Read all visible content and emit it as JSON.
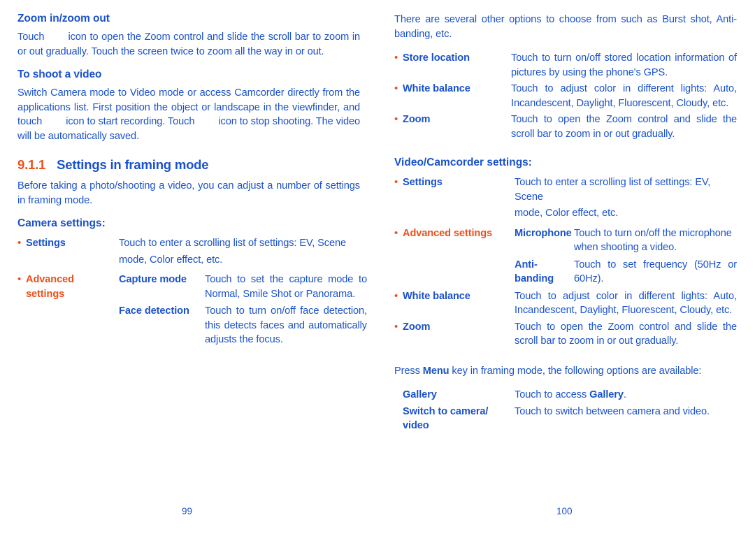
{
  "left_page": {
    "folio": "99",
    "heading_zoom": "Zoom in/zoom out",
    "para_zoom_a": "Touch",
    "para_zoom_b": "icon to open the Zoom control and slide the scroll bar to zoom in or out gradually. Touch the screen twice to zoom all the way in or out.",
    "heading_video": "To shoot a video",
    "para_video_a": "Switch Camera mode to Video mode or access Camcorder directly from the applications list. First position the object or landscape in the viewfinder, and touch",
    "para_video_b": "icon to start recording. Touch",
    "para_video_c": "icon to stop shooting. The video will be automatically saved.",
    "section_number": "9.1.1",
    "section_title": "Settings in framing mode",
    "para_before": "Before taking a photo/shooting a video, you can adjust a number of settings in framing mode.",
    "camera_settings_head": "Camera settings:",
    "rows": [
      {
        "bullet": "•",
        "term": "Settings",
        "desc": "Touch to enter a scrolling list of settings: EV, Scene"
      },
      {
        "desc_cont": "mode, Color effect, etc."
      },
      {
        "bullet": "•",
        "term": "Advanced",
        "term2": "settings",
        "sub": "Capture mode",
        "desc": "Touch to set the capture mode to Normal, Smile Shot or Panorama."
      },
      {
        "sub": "Face detection",
        "desc": "Touch to turn on/off face detection, this detects faces and automatically adjusts the focus."
      }
    ]
  },
  "right_page": {
    "folio": "100",
    "para_options": "There are several other options to choose from such as Burst shot, Anti-banding, etc.",
    "camera_rows": [
      {
        "bullet": "•",
        "term": "Store location",
        "desc": "Touch to turn on/off stored location information of pictures by using the phone's GPS."
      },
      {
        "bullet": "•",
        "term": "White balance",
        "desc": "Touch to adjust color in different lights: Auto, Incandescent, Daylight, Fluorescent, Cloudy, etc."
      },
      {
        "bullet": "•",
        "term": "Zoom",
        "desc": "Touch to open the Zoom control and slide the scroll bar to zoom in or out gradually."
      }
    ],
    "video_settings_head": "Video/Camcorder settings:",
    "video_rows": [
      {
        "bullet": "•",
        "term": "Settings",
        "desc": "Touch to enter a scrolling list of settings: EV, Scene"
      },
      {
        "desc_cont": "mode, Color effect, etc."
      },
      {
        "bullet": "•",
        "term": "Advanced settings",
        "sub": "Microphone",
        "desc": "Touch to turn on/off the microphone when shooting a video."
      },
      {
        "sub": "Anti-",
        "sub2": "banding",
        "desc": "Touch to set frequency (50Hz or 60Hz)."
      },
      {
        "bullet": "•",
        "term": "White balance",
        "desc": "Touch to adjust color in different lights: Auto, Incandescent, Daylight, Fluorescent, Cloudy, etc."
      },
      {
        "bullet": "•",
        "term": "Zoom",
        "desc": "Touch to open the Zoom control and slide the scroll bar to zoom in or out gradually."
      }
    ],
    "press_menu_a": "Press ",
    "press_menu_key": "Menu",
    "press_menu_b": " key in framing mode, the following options are available:",
    "menu_rows": [
      {
        "term": "Gallery",
        "desc_a": "Touch to access ",
        "desc_bold": "Gallery",
        "desc_b": "."
      },
      {
        "term": "Switch to camera/",
        "term2": "video",
        "desc_a": "Touch to switch between camera and video.",
        "desc_bold": "",
        "desc_b": ""
      }
    ]
  },
  "colors": {
    "text_blue": "#1A52CC",
    "accent_orange": "#EE5019",
    "background": "#FFFFFF"
  }
}
